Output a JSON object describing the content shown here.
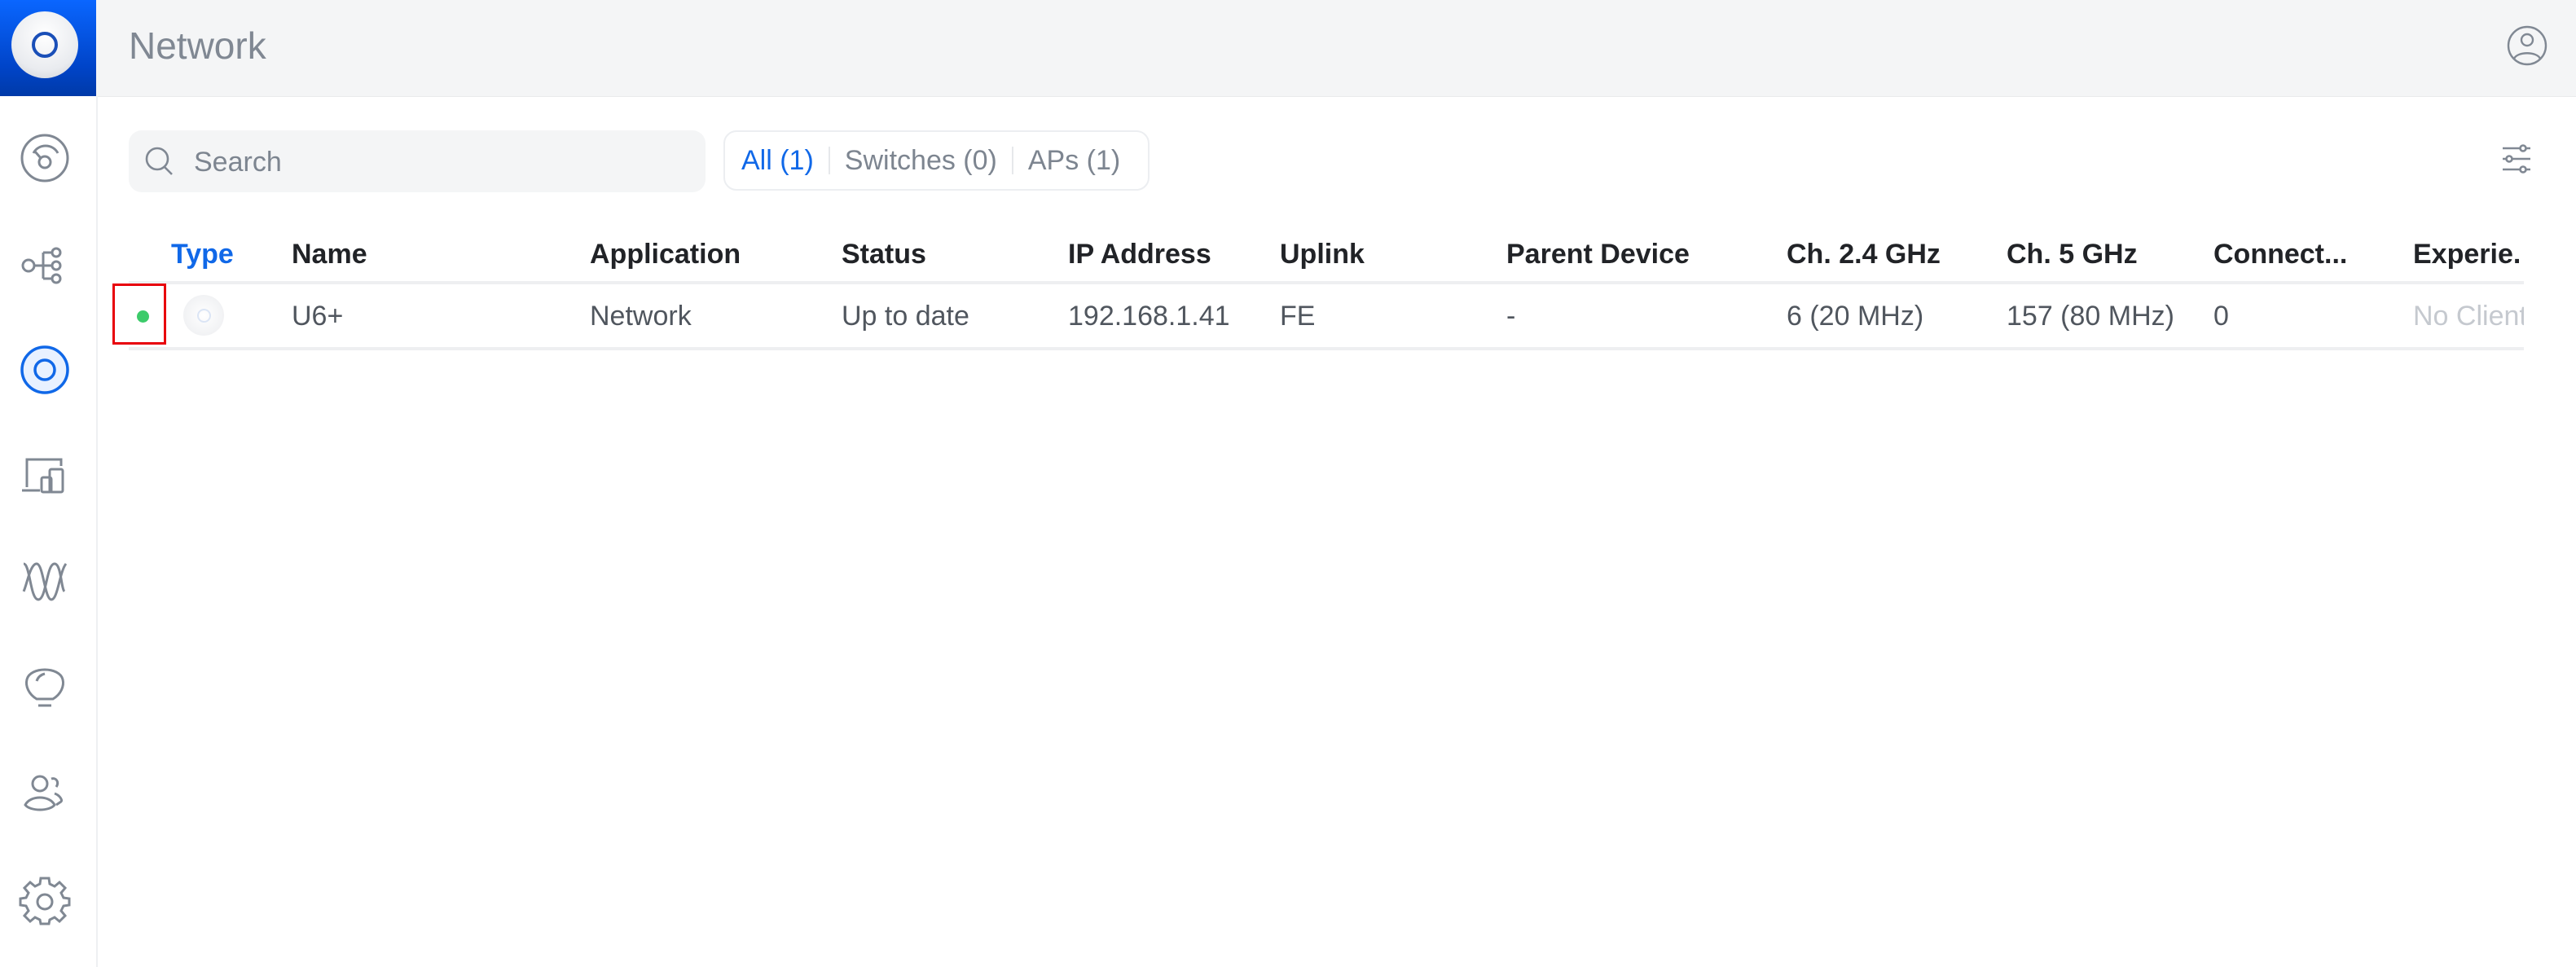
{
  "header": {
    "title": "Network",
    "logo_icon": "unifi-ap-logo",
    "user_icon": "user-circle-icon"
  },
  "sidebar": {
    "items": [
      {
        "name": "dashboard",
        "icon": "gauge-icon",
        "active": false
      },
      {
        "name": "topology",
        "icon": "topology-icon",
        "active": false
      },
      {
        "name": "devices",
        "icon": "access-point-icon",
        "active": true
      },
      {
        "name": "clients",
        "icon": "client-devices-icon",
        "active": false
      },
      {
        "name": "statistics",
        "icon": "waveform-icon",
        "active": false
      },
      {
        "name": "insights",
        "icon": "lightbulb-icon",
        "active": false
      },
      {
        "name": "admins",
        "icon": "users-icon",
        "active": false
      },
      {
        "name": "settings",
        "icon": "gear-icon",
        "active": false
      }
    ]
  },
  "toolbar": {
    "search_placeholder": "Search",
    "search_value": "",
    "filters": [
      {
        "label": "All (1)",
        "active": true
      },
      {
        "label": "Switches (0)",
        "active": false
      },
      {
        "label": "APs (1)",
        "active": false
      }
    ],
    "column_settings_icon": "sliders-icon"
  },
  "table": {
    "columns": [
      "Type",
      "Name",
      "Application",
      "Status",
      "IP Address",
      "Uplink",
      "Parent Device",
      "Ch. 2.4 GHz",
      "Ch. 5 GHz",
      "Connect...",
      "Experie."
    ],
    "sorted_column": "Type",
    "rows": [
      {
        "status": "online",
        "type_icon": "access-point-icon",
        "name": "U6+",
        "application": "Network",
        "status_text": "Up to date",
        "ip_address": "192.168.1.41",
        "uplink": "FE",
        "parent_device": "-",
        "ch_24": "6 (20 MHz)",
        "ch_5": "157 (80 MHz)",
        "connected": "0",
        "experience": "No Clients"
      }
    ]
  },
  "colors": {
    "accent": "#1068e8",
    "online": "#3ccb6a",
    "highlight": "#e8000b"
  }
}
